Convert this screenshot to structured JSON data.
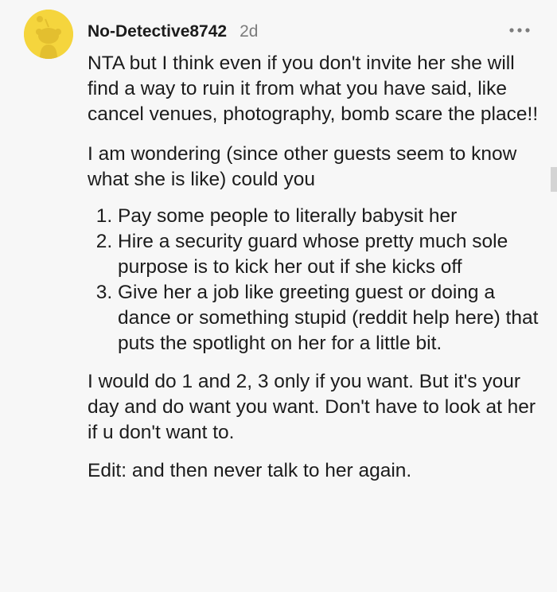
{
  "comment": {
    "username": "No-Detective8742",
    "age": "2d",
    "avatar_icon": "reddit-snoo-avatar-icon",
    "avatar_color": "#f5d53d",
    "more_icon": "more-options-icon",
    "paragraphs": [
      "NTA but I think even if you don't invite her she will find a way to ruin it from what you have said, like cancel venues, photography, bomb scare the place!!",
      "I am wondering (since other guests seem to know what she is like) could you"
    ],
    "list_items": [
      "Pay some people to literally babysit her",
      "Hire a security guard whose pretty much sole purpose is to kick her out if she kicks off",
      "Give her a job like greeting guest or doing a dance or something stupid (reddit help here) that puts the spotlight on her for a little bit."
    ],
    "closing_paragraphs": [
      "I would do 1 and 2, 3 only if you want. But it's your day and do want you want. Don't have to look at her if u don't want to.",
      "Edit: and then never talk to her again."
    ]
  }
}
